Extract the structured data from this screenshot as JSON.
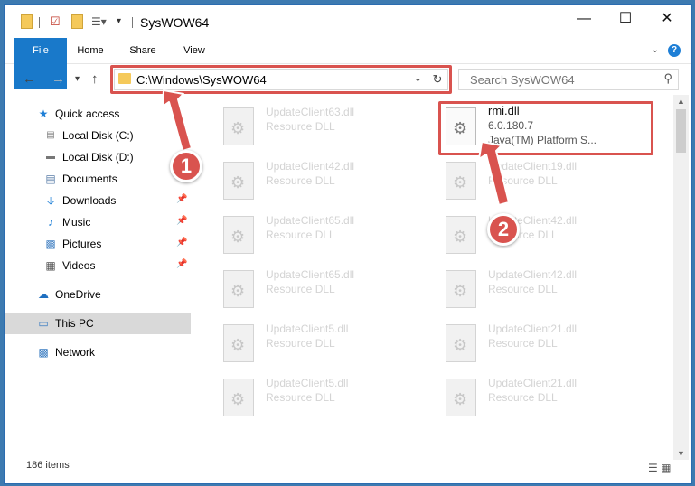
{
  "window": {
    "title": "SysWOW64",
    "minimize": "—",
    "maximize": "☐",
    "close": "✕"
  },
  "ribbon": {
    "tabs": [
      "File",
      "Home",
      "Share",
      "View"
    ],
    "help": "?"
  },
  "address": {
    "path": "C:\\Windows\\SysWOW64",
    "search_placeholder": "Search SysWOW64"
  },
  "sidebar": {
    "items": [
      {
        "label": "Quick access",
        "icon": "star-icon",
        "pinned": false
      },
      {
        "label": "Local Disk (C:)",
        "icon": "drive-icon",
        "pinned": false
      },
      {
        "label": "Local Disk (D:)",
        "icon": "drive-icon",
        "pinned": false
      },
      {
        "label": "Documents",
        "icon": "documents-icon",
        "pinned": false
      },
      {
        "label": "Downloads",
        "icon": "download-icon",
        "pinned": true
      },
      {
        "label": "Music",
        "icon": "music-icon",
        "pinned": true
      },
      {
        "label": "Pictures",
        "icon": "pictures-icon",
        "pinned": true
      },
      {
        "label": "Videos",
        "icon": "videos-icon",
        "pinned": true
      },
      {
        "label": "OneDrive",
        "icon": "cloud-icon",
        "pinned": false
      },
      {
        "label": "This PC",
        "icon": "computer-icon",
        "pinned": false,
        "selected": true
      },
      {
        "label": "Network",
        "icon": "network-icon",
        "pinned": false
      }
    ]
  },
  "files": {
    "left_column": [
      {
        "name": "UpdateClient63.dll",
        "type": "Resource DLL"
      },
      {
        "name": "UpdateClient42.dll",
        "type": "Resource DLL"
      },
      {
        "name": "UpdateClient65.dll",
        "type": "Resource DLL"
      },
      {
        "name": "UpdateClient65.dll",
        "type": "Resource DLL"
      },
      {
        "name": "UpdateClient5.dll",
        "type": "Resource DLL"
      },
      {
        "name": "UpdateClient5.dll",
        "type": "Resource DLL"
      }
    ],
    "right_column": [
      {
        "name": "UpdateClient19.dll",
        "type": "Resource DLL"
      },
      {
        "name": "UpdateClient42.dll",
        "type": "Resource DLL"
      },
      {
        "name": "UpdateClient42.dll",
        "type": "Resource DLL"
      },
      {
        "name": "UpdateClient21.dll",
        "type": "Resource DLL"
      },
      {
        "name": "UpdateClient21.dll",
        "type": "Resource DLL"
      }
    ],
    "selected": {
      "name": "rmi.dll",
      "version": "6.0.180.7",
      "description": "Java(TM) Platform S..."
    }
  },
  "status": {
    "item_count": "186 items"
  },
  "callouts": {
    "one": "1",
    "two": "2"
  },
  "colors": {
    "accent": "#1979ca",
    "highlight": "#d9534f",
    "desktop": "#3d7ab0"
  }
}
